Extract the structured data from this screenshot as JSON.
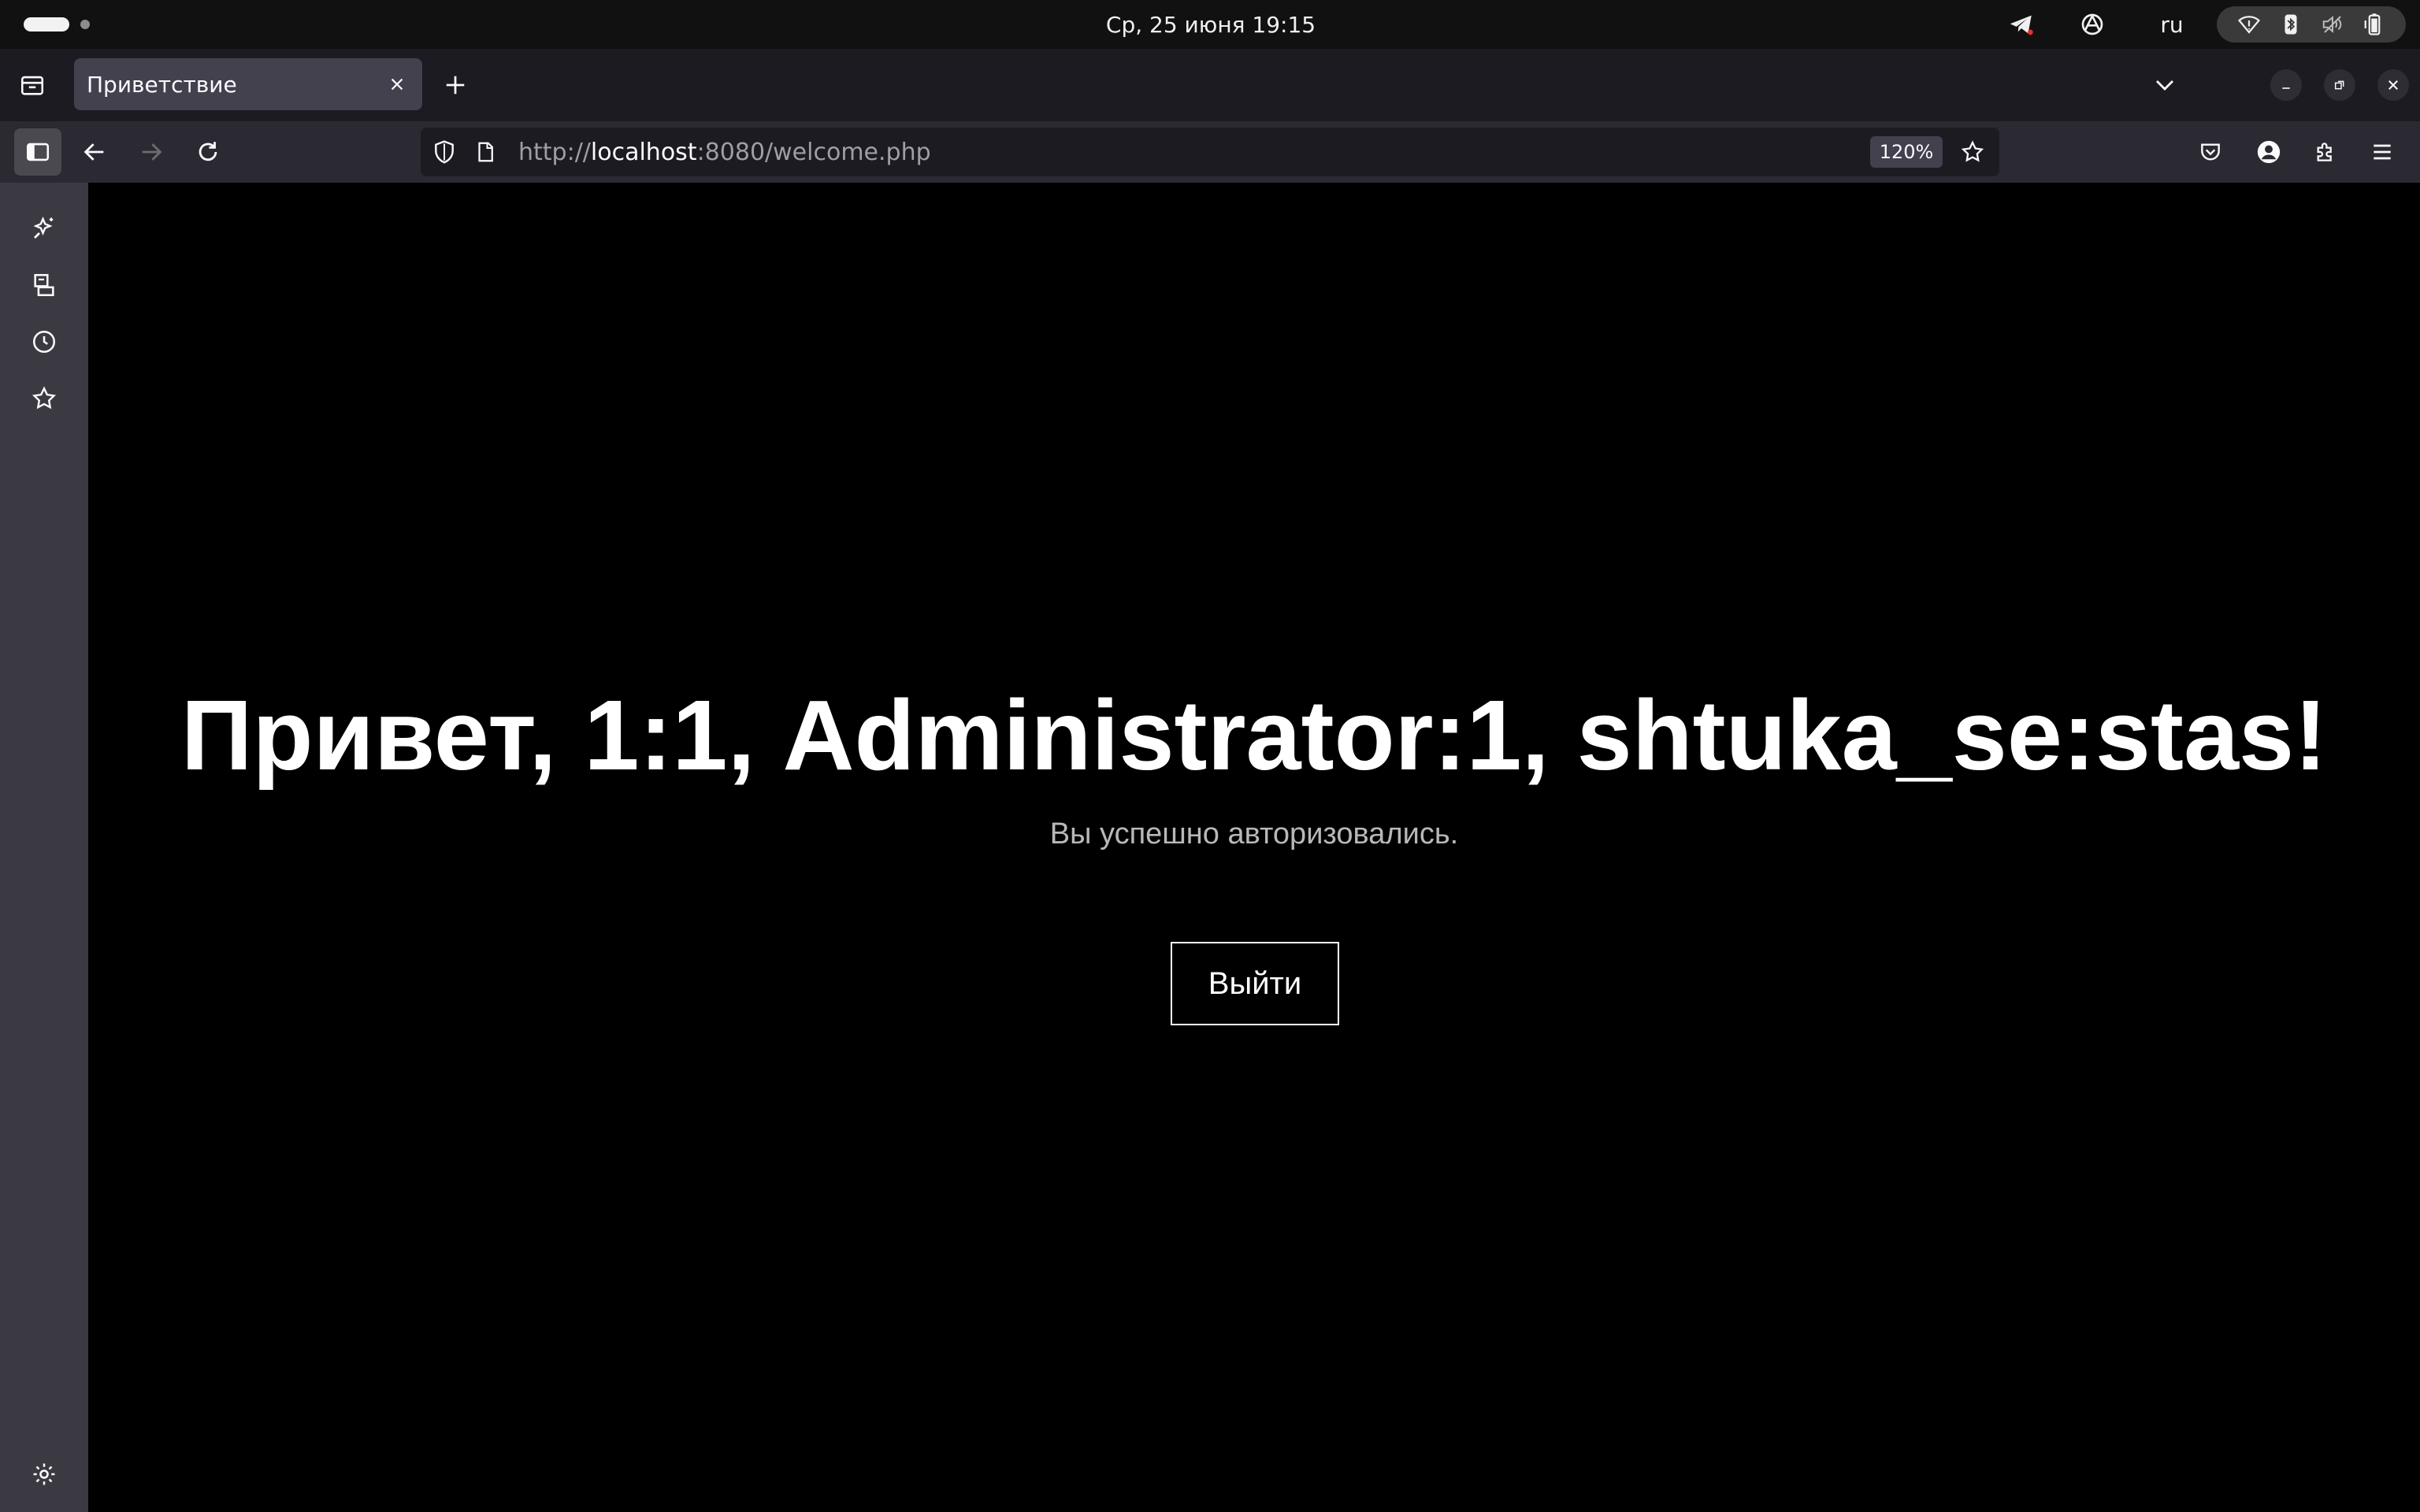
{
  "system_bar": {
    "clock": "Ср, 25 июня  19:15",
    "keyboard_layout": "ru",
    "tray_icons": [
      "telegram-icon",
      "vpn-icon"
    ],
    "status_icons": [
      "wifi-icon",
      "bluetooth-icon",
      "volume-muted-icon",
      "battery-icon"
    ]
  },
  "browser": {
    "tab": {
      "title": "Приветствие"
    },
    "url": {
      "scheme": "http://",
      "host": "localhost",
      "rest": ":8080/welcome.php"
    },
    "zoom": "120%"
  },
  "sidebar": {
    "items": [
      "ai-chatbot-icon",
      "synced-tabs-icon",
      "history-icon",
      "bookmarks-icon"
    ],
    "bottom": "settings-icon"
  },
  "page": {
    "greeting": "Привет, 1:1, Administrator:1, shtuka_se:stas!",
    "subtitle": "Вы успешно авторизовались.",
    "logout_label": "Выйти"
  },
  "colors": {
    "page_background": "#000000",
    "toolbar": "#2b2a33",
    "tabstrip": "#1c1b22",
    "sidebar": "#3b3a42"
  }
}
